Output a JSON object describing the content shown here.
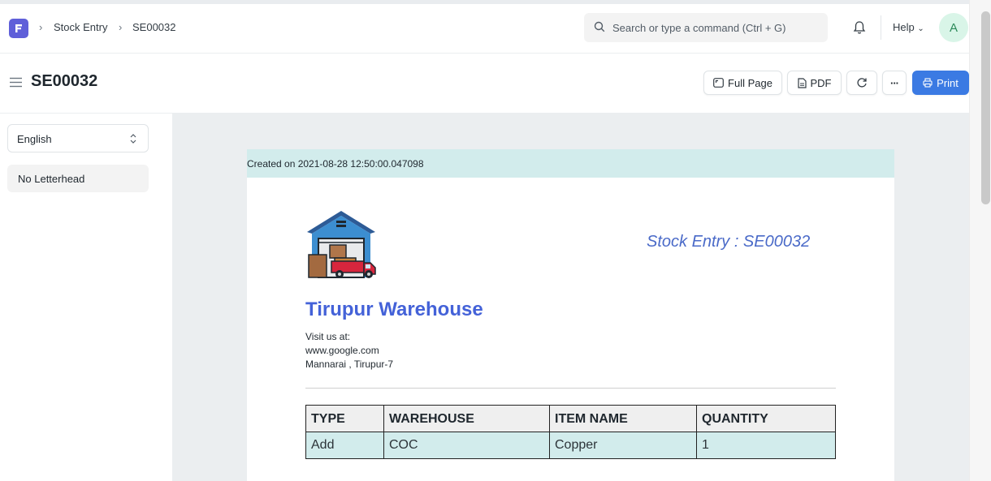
{
  "navbar": {
    "breadcrumbs": [
      "Stock Entry",
      "SE00032"
    ],
    "search_placeholder": "Search or type a command (Ctrl + G)",
    "help_label": "Help",
    "avatar_initial": "A"
  },
  "page": {
    "title": "SE00032",
    "buttons": {
      "full_page": "Full Page",
      "pdf": "PDF",
      "more": "···",
      "print": "Print"
    }
  },
  "sidebar": {
    "language": "English",
    "letterhead": "No Letterhead"
  },
  "print_preview": {
    "created_text": "Created on 2021-08-28 12:50:00.047098",
    "doc_title": "Stock Entry : SE00032",
    "company_name": "Tirupur Warehouse",
    "address_lines": [
      "Visit us at:",
      "www.google.com",
      "Mannarai , Tirupur-7"
    ],
    "table": {
      "headers": [
        "TYPE",
        "WAREHOUSE",
        "ITEM NAME",
        "QUANTITY"
      ],
      "rows": [
        [
          "Add",
          "COC",
          "Copper",
          "1"
        ]
      ]
    }
  },
  "colors": {
    "brand": "#5f5fd9",
    "primary_button": "#3b7ae3",
    "company_title": "#4462d8",
    "banner": "#d2ecec"
  }
}
